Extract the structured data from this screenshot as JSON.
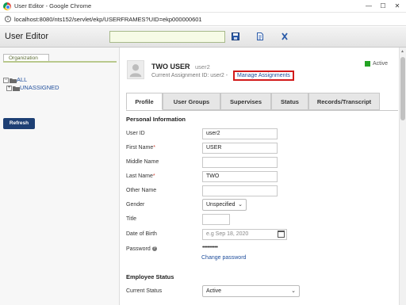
{
  "window": {
    "title": "User Editor - Google Chrome",
    "minimize": "—",
    "maximize": "☐",
    "close": "✕",
    "url": "localhost:8080/nts152/servlet/ekp/USERFRAMES?UID=ekp000000601"
  },
  "app": {
    "title": "User Editor",
    "search_value": ""
  },
  "sidebar": {
    "tab_label": "Organization",
    "tree": [
      {
        "expander": "−",
        "label": "ALL"
      },
      {
        "expander": "+",
        "label": "UNASSIGNED"
      }
    ],
    "refresh_label": "Refresh"
  },
  "user": {
    "display_name": "TWO USER",
    "user_id": "user2",
    "assignment_text": "Current Assignment ID: user2 -",
    "manage_link": "Manage Assignments",
    "status": "Active",
    "status_color": "#23a323"
  },
  "tabs": [
    {
      "label": "Profile",
      "active": true
    },
    {
      "label": "User Groups",
      "active": false
    },
    {
      "label": "Supervises",
      "active": false
    },
    {
      "label": "Status",
      "active": false
    },
    {
      "label": "Records/Transcript",
      "active": false
    }
  ],
  "personal": {
    "section_title": "Personal Information",
    "user_id_label": "User ID",
    "user_id_value": "user2",
    "first_name_label": "First Name",
    "first_name_value": "USER",
    "middle_name_label": "Middle Name",
    "middle_name_value": "",
    "last_name_label": "Last Name",
    "last_name_value": "TWO",
    "other_name_label": "Other Name",
    "other_name_value": "",
    "gender_label": "Gender",
    "gender_value": "Unspecified",
    "title_label": "Title",
    "title_value": "",
    "dob_label": "Date of Birth",
    "dob_placeholder": "e.g Sep 18, 2020",
    "password_label": "Password",
    "password_value": "••••••••••",
    "change_password": "Change password",
    "required_mark": "*"
  },
  "employee": {
    "section_title": "Employee Status",
    "current_status_label": "Current Status",
    "current_status_value": "Active"
  }
}
